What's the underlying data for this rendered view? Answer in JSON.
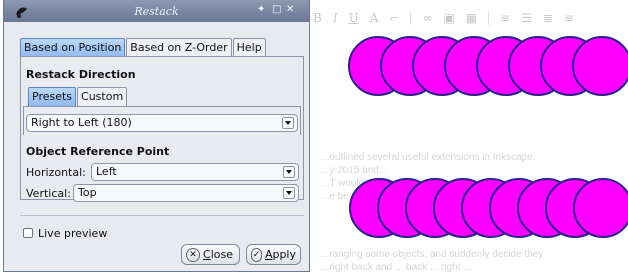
{
  "window": {
    "title": "Restack",
    "controls": [
      "✦",
      "□",
      "✕"
    ]
  },
  "tabs": [
    "Based on Position",
    "Based on Z-Order",
    "Help"
  ],
  "restack": {
    "section_title": "Restack Direction",
    "inner_tabs": [
      "Presets",
      "Custom"
    ],
    "preset_value": "Right to Left (180)"
  },
  "reference": {
    "section_title": "Object Reference Point",
    "horizontal_label": "Horizontal:",
    "horizontal_value": "Left",
    "vertical_label": "Vertical:",
    "vertical_value": "Top"
  },
  "live_preview": {
    "label": "Live preview",
    "checked": false
  },
  "buttons": {
    "close_label": "Close",
    "close_underline": "C",
    "apply_label": "Apply",
    "apply_underline": "A"
  },
  "document": {
    "faded_lines": [
      "...outlined several useful extensions in Inkscape.",
      "...y 2015 and...",
      "...T would ... view ... tab...",
      "...e be ... in ... interface...",
      "...ranging some objects, and suddenly decide they",
      "...right back and ... back ... right ... "
    ]
  },
  "circles": {
    "fill": "#ff00ff",
    "stroke": "#2a1f8f",
    "row_top_count": 8,
    "row_bottom_count": 9
  },
  "colors": {
    "titlebar": "#7c86a4",
    "tab_active": "#a8c9f3",
    "dialog_bg": "#e9eaf0"
  }
}
